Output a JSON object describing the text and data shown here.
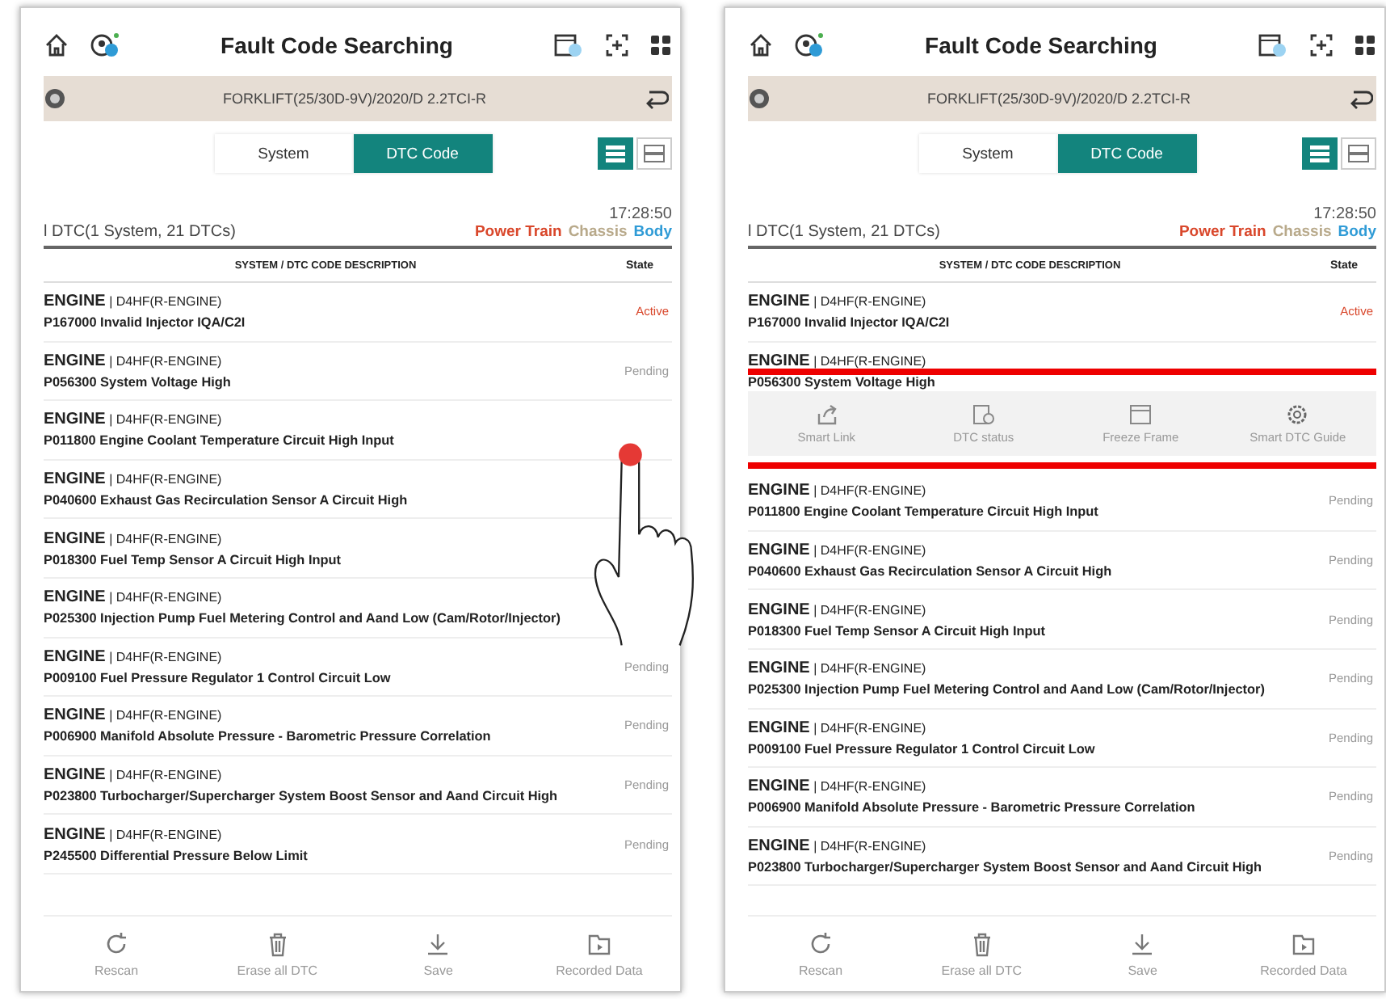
{
  "screens": [
    {
      "touch_gesture": true,
      "title": "Fault Code Searching",
      "vehicle": "FORKLIFT(25/30D-9V)/2020/D 2.2TCI-R",
      "tabs": [
        {
          "label": "System",
          "selected": false
        },
        {
          "label": "DTC Code",
          "selected": true
        }
      ],
      "view_toggle": [
        {
          "kind": "list",
          "selected": true
        },
        {
          "kind": "grid",
          "selected": false
        }
      ],
      "time": "17:28:50",
      "summary": "l DTC(1 System, 21 DTCs)",
      "legend": [
        {
          "label": "Power Train",
          "color": "#d9472b"
        },
        {
          "label": "Chassis",
          "color": "#b8a98a"
        },
        {
          "label": "Body",
          "color": "#2f9bd6"
        }
      ],
      "columns": [
        "SYSTEM / DTC CODE DESCRIPTION",
        "State"
      ],
      "rows": [
        {
          "kind": "dtc",
          "system": "**ENGINE** | D4HF(R-ENGINE)",
          "code": "P167000 Invalid Injector IQA/C2I",
          "state": "Active",
          "active": true
        },
        {
          "kind": "dtc",
          "system": "**ENGINE** | D4HF(R-ENGINE)",
          "code": "P056300 System Voltage High",
          "state": "Pending",
          "active": false
        },
        {
          "kind": "dtc",
          "system": "**ENGINE** | D4HF(R-ENGINE)",
          "code": "P011800 Engine Coolant Temperature Circuit High Input"
        },
        {
          "kind": "dtc",
          "system": "**ENGINE** | D4HF(R-ENGINE)",
          "code": "P040600 Exhaust Gas Recirculation Sensor A Circuit High"
        },
        {
          "kind": "dtc",
          "system": "**ENGINE** | D4HF(R-ENGINE)",
          "code": "P018300 Fuel Temp Sensor A Circuit High Input"
        },
        {
          "kind": "dtc",
          "system": "**ENGINE** | D4HF(R-ENGINE)",
          "code": "P025300 Injection Pump Fuel Metering Control and Aand  Low (Cam/Rotor/Injector)"
        },
        {
          "kind": "dtc",
          "system": "**ENGINE** | D4HF(R-ENGINE)",
          "code": "P009100 Fuel Pressure Regulator 1 Control Circuit Low",
          "state": "Pending",
          "active": false
        },
        {
          "kind": "dtc",
          "system": "**ENGINE** | D4HF(R-ENGINE)",
          "code": "P006900 Manifold Absolute Pressure - Barometric Pressure Correlation",
          "state": "Pending",
          "active": false
        },
        {
          "kind": "dtc",
          "system": "**ENGINE** | D4HF(R-ENGINE)",
          "code": "P023800 Turbocharger/Supercharger System Boost Sensor and Aand  Circuit High",
          "state": "Pending",
          "active": false
        },
        {
          "kind": "dtc",
          "system": "**ENGINE** | D4HF(R-ENGINE)",
          "code": "P245500 Differential Pressure Below Limit",
          "state": "Pending",
          "active": false
        }
      ],
      "footer": [
        {
          "kind": "rescan",
          "label": "Rescan"
        },
        {
          "kind": "erase",
          "label": "Erase all DTC"
        },
        {
          "kind": "save",
          "label": "Save"
        },
        {
          "kind": "recorded",
          "label": "Recorded Data"
        }
      ]
    },
    {
      "touch_gesture": false,
      "title": "Fault Code Searching",
      "vehicle": "FORKLIFT(25/30D-9V)/2020/D 2.2TCI-R",
      "tabs": [
        {
          "label": "System",
          "selected": false
        },
        {
          "label": "DTC Code",
          "selected": true
        }
      ],
      "view_toggle": [
        {
          "kind": "list",
          "selected": true
        },
        {
          "kind": "grid",
          "selected": false
        }
      ],
      "time": "17:28:50",
      "summary": "l DTC(1 System, 21 DTCs)",
      "legend": [
        {
          "label": "Power Train",
          "color": "#d9472b"
        },
        {
          "label": "Chassis",
          "color": "#b8a98a"
        },
        {
          "label": "Body",
          "color": "#2f9bd6"
        }
      ],
      "columns": [
        "SYSTEM / DTC CODE DESCRIPTION",
        "State"
      ],
      "rows": [
        {
          "kind": "dtc",
          "system": "**ENGINE** | D4HF(R-ENGINE)",
          "code": "P167000 Invalid Injector IQA/C2I",
          "state": "Active",
          "active": true
        },
        {
          "kind": "dtc",
          "system": "**ENGINE** | D4HF(R-ENGINE)",
          "code": "P056300 System Voltage High"
        },
        {
          "kind": "menu",
          "highlighted": true,
          "items": [
            {
              "kind": "link",
              "label": "Smart Link"
            },
            {
              "kind": "status",
              "label": "DTC status"
            },
            {
              "kind": "freeze",
              "label": "Freeze Frame"
            },
            {
              "kind": "guide",
              "label": "Smart DTC Guide"
            }
          ]
        },
        {
          "kind": "dtc",
          "system": "**ENGINE** | D4HF(R-ENGINE)",
          "code": "P011800 Engine Coolant Temperature Circuit High Input",
          "state": "Pending",
          "active": false
        },
        {
          "kind": "dtc",
          "system": "**ENGINE** | D4HF(R-ENGINE)",
          "code": "P040600 Exhaust Gas Recirculation Sensor A Circuit High",
          "state": "Pending",
          "active": false
        },
        {
          "kind": "dtc",
          "system": "**ENGINE** | D4HF(R-ENGINE)",
          "code": "P018300 Fuel Temp Sensor A Circuit High Input",
          "state": "Pending",
          "active": false
        },
        {
          "kind": "dtc",
          "system": "**ENGINE** | D4HF(R-ENGINE)",
          "code": "P025300 Injection Pump Fuel Metering Control and Aand  Low (Cam/Rotor/Injector)",
          "state": "Pending",
          "active": false
        },
        {
          "kind": "dtc",
          "system": "**ENGINE** | D4HF(R-ENGINE)",
          "code": "P009100 Fuel Pressure Regulator 1 Control Circuit Low",
          "state": "Pending",
          "active": false
        },
        {
          "kind": "dtc",
          "system": "**ENGINE** | D4HF(R-ENGINE)",
          "code": "P006900 Manifold Absolute Pressure - Barometric Pressure Correlation",
          "state": "Pending",
          "active": false
        },
        {
          "kind": "dtc",
          "system": "**ENGINE** | D4HF(R-ENGINE)",
          "code": "P023800 Turbocharger/Supercharger System Boost Sensor and Aand  Circuit High",
          "state": "Pending",
          "active": false
        }
      ],
      "footer": [
        {
          "kind": "rescan",
          "label": "Rescan"
        },
        {
          "kind": "erase",
          "label": "Erase all DTC"
        },
        {
          "kind": "save",
          "label": "Save"
        },
        {
          "kind": "recorded",
          "label": "Recorded Data"
        }
      ]
    }
  ]
}
